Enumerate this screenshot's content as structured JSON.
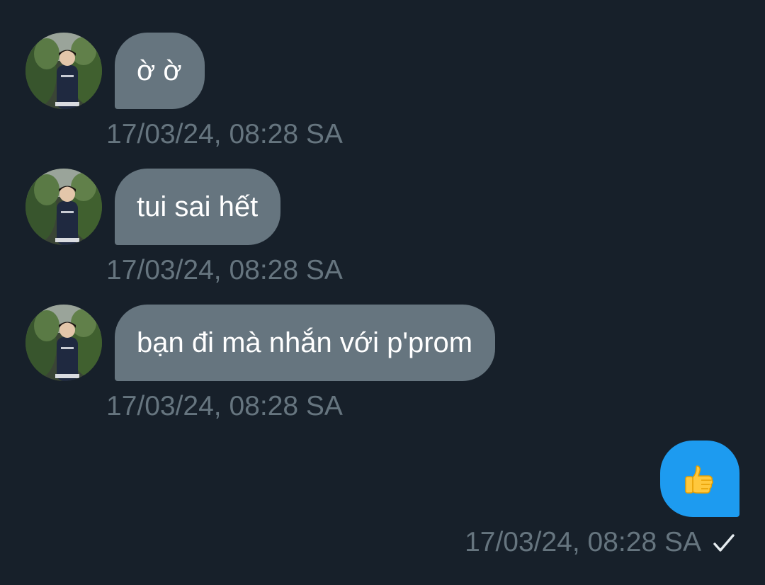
{
  "conversation": {
    "messages": [
      {
        "direction": "incoming",
        "text": "ờ ờ",
        "time": "17/03/24, 08:28 SA"
      },
      {
        "direction": "incoming",
        "text": "tui sai hết",
        "time": "17/03/24, 08:28 SA"
      },
      {
        "direction": "incoming",
        "text": "bạn đi mà nhắn với p'prom",
        "time": "17/03/24, 08:28 SA"
      },
      {
        "direction": "outgoing",
        "emoji": "thumbs-up",
        "time": "17/03/24, 08:28 SA",
        "status_icon": "checkmark-icon"
      }
    ]
  },
  "colors": {
    "background": "#17202a",
    "incoming_bubble": "#66757f",
    "outgoing_bubble": "#1d9bf0",
    "timestamp": "#66757f",
    "message_text": "#ffffff"
  }
}
